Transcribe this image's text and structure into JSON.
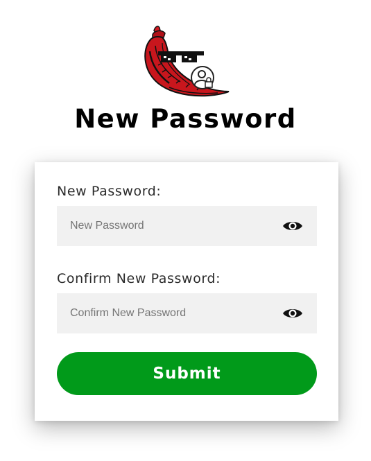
{
  "header": {
    "logo_icon": "chili-pepper-sunglasses-lock-logo",
    "title": "New Password"
  },
  "form": {
    "new_password": {
      "label": "New Password:",
      "placeholder": "New Password",
      "value": "",
      "toggle_icon": "eye-icon"
    },
    "confirm_password": {
      "label": "Confirm New Password:",
      "placeholder": "Confirm New Password",
      "value": "",
      "toggle_icon": "eye-icon"
    },
    "submit_label": "Submit"
  },
  "colors": {
    "submit_bg": "#019a1a",
    "input_bg": "#f1f1f1",
    "logo_red": "#c8161d"
  }
}
